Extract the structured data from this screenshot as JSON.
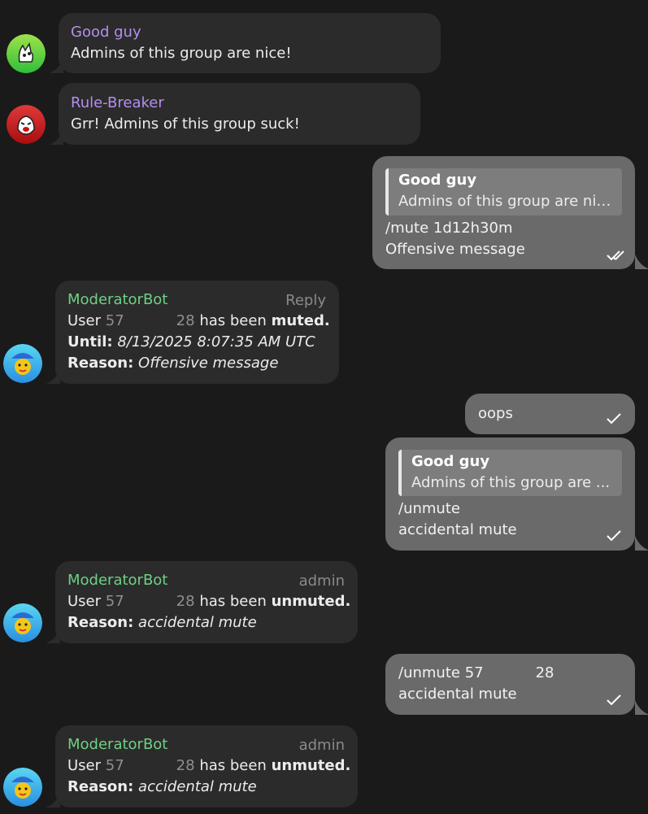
{
  "messages": {
    "m1": {
      "sender": "Good guy",
      "text": "Admins of this group are nice!"
    },
    "m2": {
      "sender": "Rule-Breaker",
      "text": "Grr! Admins of this group suck!"
    },
    "m3": {
      "quote_name": "Good guy",
      "quote_text": "Admins of this group are nice!",
      "line1": "/mute 1d12h30m",
      "line2": "Offensive message"
    },
    "m4": {
      "sender": "ModeratorBot",
      "meta": "Reply",
      "user_label": "User",
      "user_id_a": "57",
      "user_id_b": "28",
      "action_text": "has been",
      "action": "muted.",
      "until_label": "Until:",
      "until_value": "8/13/2025 8:07:35 AM UTC",
      "reason_label": "Reason:",
      "reason_value": "Offensive message"
    },
    "m5": {
      "text": "oops"
    },
    "m6": {
      "quote_name": "Good guy",
      "quote_text": "Admins of this group are ...",
      "line1": "/unmute",
      "line2": "accidental mute"
    },
    "m7": {
      "sender": "ModeratorBot",
      "meta": "admin",
      "user_label": "User",
      "user_id_a": "57",
      "user_id_b": "28",
      "action_text": "has been",
      "action": "unmuted.",
      "reason_label": "Reason:",
      "reason_value": "accidental mute"
    },
    "m8": {
      "line1_cmd": "/unmute",
      "line1_a": "57",
      "line1_b": "28",
      "line2": "accidental mute"
    },
    "m9": {
      "sender": "ModeratorBot",
      "meta": "admin",
      "user_label": "User",
      "user_id_a": "57",
      "user_id_b": "28",
      "action_text": "has been",
      "action": "unmuted.",
      "reason_label": "Reason:",
      "reason_value": "accidental mute"
    }
  },
  "icons": {
    "read_double_check": "double-check-icon",
    "sent_check": "check-icon"
  },
  "colors": {
    "background": "#1a1a1a",
    "incoming_bubble": "#2b2b2b",
    "outgoing_bubble": "#6a6a6a",
    "sender_purple": "#b48ef0",
    "sender_green": "#6ed183"
  }
}
